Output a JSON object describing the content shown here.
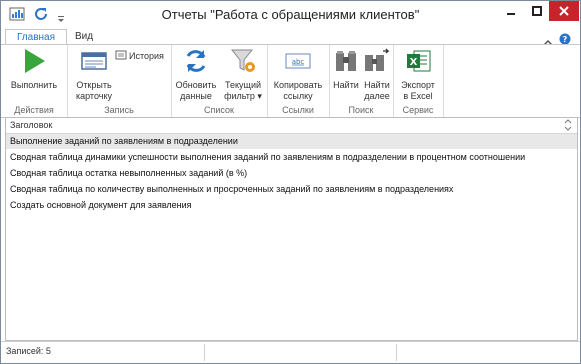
{
  "window": {
    "title": "Отчеты \"Работа с обращениями клиентов\""
  },
  "tabs": [
    {
      "label": "Главная",
      "active": true
    },
    {
      "label": "Вид",
      "active": false
    }
  ],
  "ribbon": {
    "groups": [
      {
        "label": "Действия",
        "buttons": [
          {
            "label": "Выполнить",
            "icon": "play-icon"
          }
        ]
      },
      {
        "label": "Запись",
        "buttons": [
          {
            "label1": "Открыть",
            "label2": "карточку",
            "icon": "card-icon"
          },
          {
            "label": "История",
            "icon": "history-icon"
          }
        ]
      },
      {
        "label": "Список",
        "buttons": [
          {
            "label1": "Обновить",
            "label2": "данные",
            "icon": "refresh-icon"
          },
          {
            "label1": "Текущий",
            "label2": "фильтр",
            "icon": "filter-icon"
          }
        ]
      },
      {
        "label": "Ссылки",
        "buttons": [
          {
            "label1": "Копировать",
            "label2": "ссылку",
            "icon": "link-icon"
          }
        ]
      },
      {
        "label": "Поиск",
        "buttons": [
          {
            "label": "Найти",
            "icon": "binoculars-icon"
          },
          {
            "label1": "Найти",
            "label2": "далее",
            "icon": "binoculars-next-icon"
          }
        ]
      },
      {
        "label": "Сервис",
        "buttons": [
          {
            "label1": "Экспорт",
            "label2": "в Excel",
            "icon": "excel-icon"
          }
        ]
      }
    ]
  },
  "grid": {
    "header": "Заголовок",
    "rows": [
      "Выполнение заданий по заявлениям в подразделении",
      "Сводная таблица динамики успешности выполнения заданий  по заявлениям в подразделении в процентном соотношении",
      "Сводная таблица остатка невыполненных заданий (в %)",
      "Сводная таблица по количеству выполненных и просроченных заданий по заявлениям в подразделениях",
      "Создать основной документ для заявления"
    ]
  },
  "status": {
    "records": "Записей: 5"
  },
  "colors": {
    "accent": "#2a73c4",
    "play": "#3aa53a",
    "excel": "#1f7a3c"
  }
}
